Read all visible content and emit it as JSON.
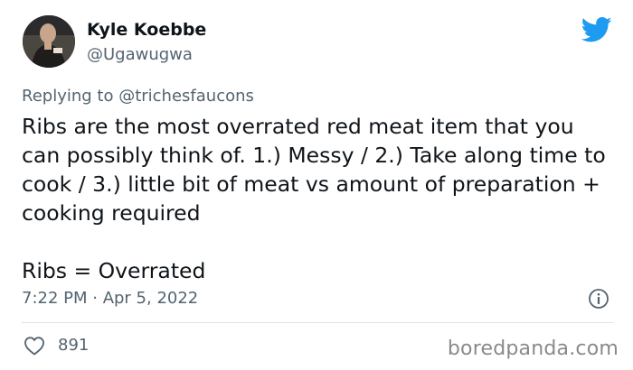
{
  "author": {
    "display_name": "Kyle Koebbe",
    "handle": "@Ugawugwa"
  },
  "reply": {
    "prefix": "Replying to ",
    "mention": "@trichesfaucons"
  },
  "tweet": {
    "text_line1": "Ribs are the most overrated red meat item that you can possibly think of. 1.) Messy / 2.) Take along time to cook / 3.) little bit of meat vs amount of preparation + cooking required",
    "text_line2": "Ribs = Overrated"
  },
  "meta": {
    "timestamp": "7:22 PM · Apr 5, 2022"
  },
  "actions": {
    "like_count": "891"
  },
  "watermark": "boredpanda.com",
  "icons": {
    "brand": "twitter-bird-icon",
    "info": "info-icon",
    "like": "heart-icon"
  },
  "colors": {
    "twitter_blue": "#1d9bf0",
    "secondary_text": "#536471",
    "primary_text": "#0f1419"
  }
}
